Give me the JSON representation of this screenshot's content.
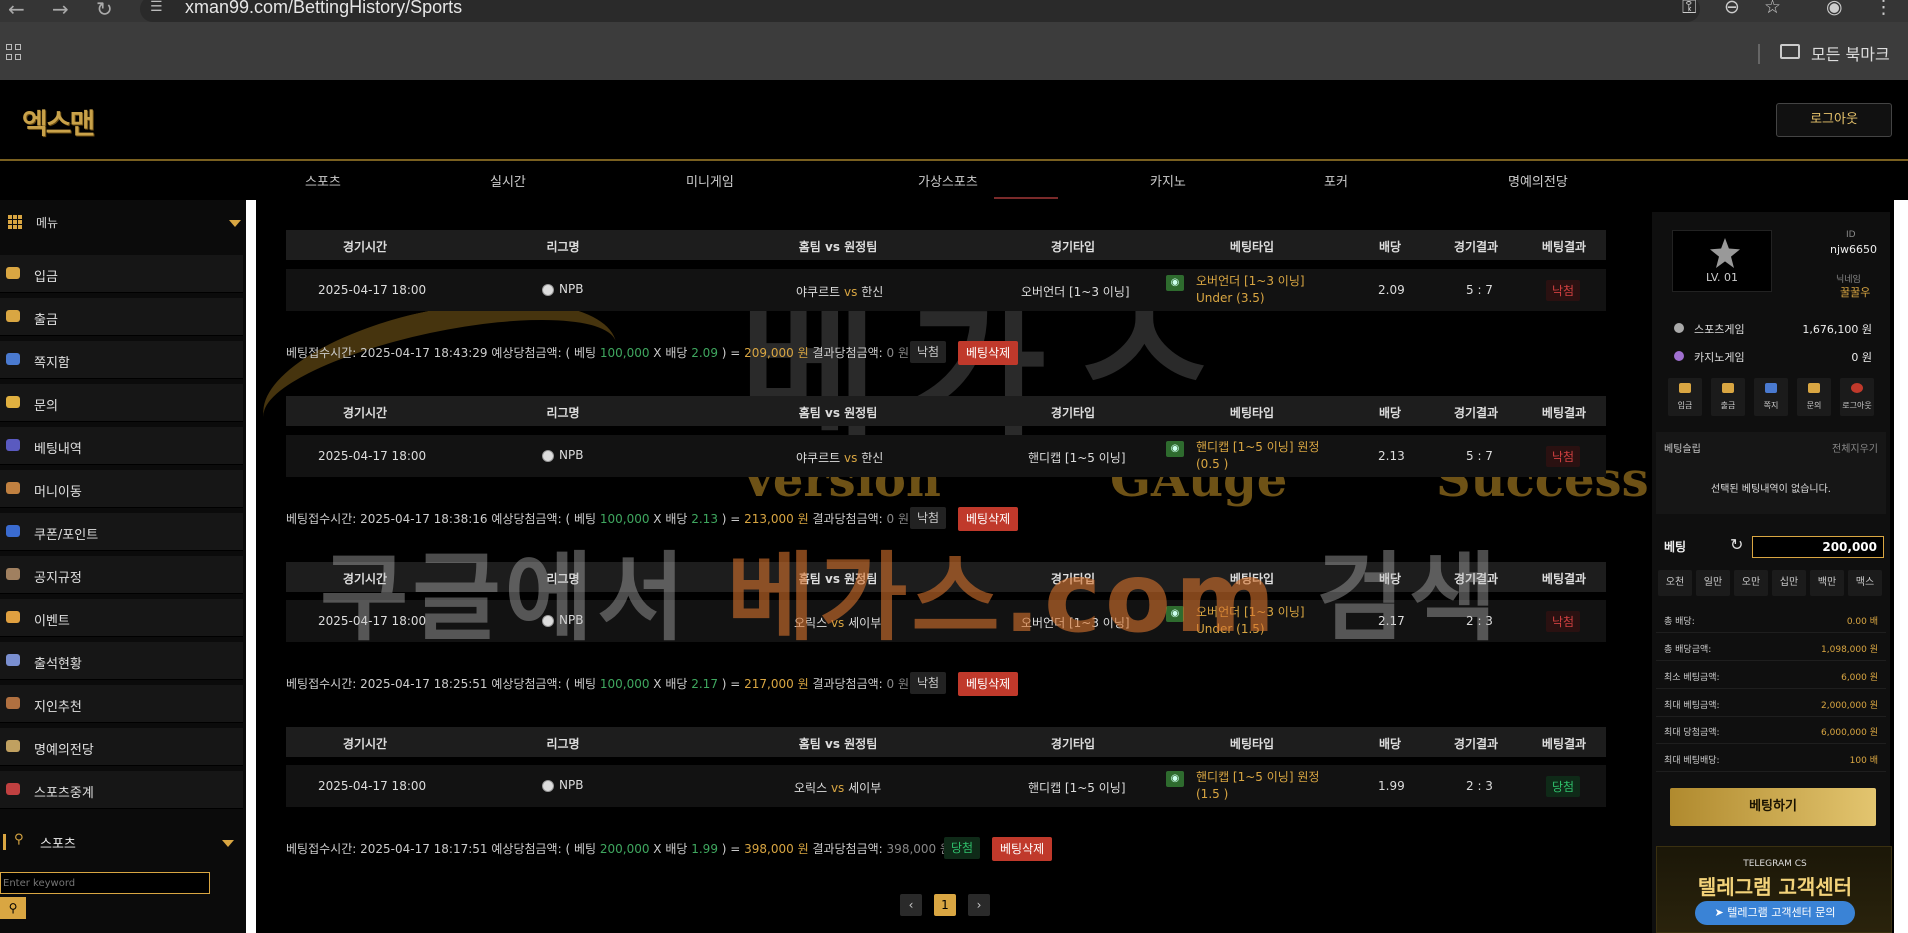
{
  "browser": {
    "url": "xman99.com/BettingHistory/Sports",
    "bookmarks_label": "모든 북마크"
  },
  "header": {
    "logout_label": "로그아웃"
  },
  "topnav": [
    "스포츠",
    "실시간",
    "미니게임",
    "가상스포츠",
    "카지노",
    "포커",
    "명예의전당"
  ],
  "sidebar": {
    "menu_title": "메뉴",
    "items": [
      "입금",
      "출금",
      "쪽지함",
      "문의",
      "베팅내역",
      "머니이동",
      "쿠폰/포인트",
      "공지규정",
      "이벤트",
      "출석현황",
      "지인추천",
      "명예의전당",
      "스포츠중계"
    ],
    "sports_label": "스포츠",
    "search_placeholder": "Enter keyword"
  },
  "columns": [
    "경기시간",
    "리그명",
    "홈팀 vs 원정팀",
    "경기타입",
    "베팅타입",
    "배당",
    "경기결과",
    "베팅결과"
  ],
  "bets": [
    {
      "time": "2025-04-17 18:00",
      "league": "NPB",
      "home": "야쿠르트",
      "vs": "vs",
      "away": "한신",
      "game_type": "오버언더 [1~3 이닝]",
      "bet_line1": "오버언더 [1~3 이닝]",
      "bet_line2": "Under (3.5)",
      "odds": "2.09",
      "score": "5 : 7",
      "result": "낙첨",
      "sum_prefix": "베팅접수시간: 2025-04-17 18:43:29  예상당첨금액: ( 베팅 ",
      "sum_stake": "100,000",
      "sum_mid": " X 배당 ",
      "sum_odds": "2.09",
      "sum_eq": " ) = ",
      "sum_expected": "209,000 원",
      "sum_paid_label": "  결과당첨금액: ",
      "sum_paid": "0 원",
      "sum_status": "낙첨",
      "delete_label": "베팅삭제"
    },
    {
      "time": "2025-04-17 18:00",
      "league": "NPB",
      "home": "야쿠르트",
      "vs": "vs",
      "away": "한신",
      "game_type": "핸디캡 [1~5 이닝]",
      "bet_line1": "핸디캡 [1~5 이닝] 원정",
      "bet_line2": "(0.5 )",
      "odds": "2.13",
      "score": "5 : 7",
      "result": "낙첨",
      "sum_prefix": "베팅접수시간: 2025-04-17 18:38:16  예상당첨금액: ( 베팅 ",
      "sum_stake": "100,000",
      "sum_mid": " X 배당 ",
      "sum_odds": "2.13",
      "sum_eq": " ) = ",
      "sum_expected": "213,000 원",
      "sum_paid_label": "  결과당첨금액: ",
      "sum_paid": "0 원",
      "sum_status": "낙첨",
      "delete_label": "베팅삭제"
    },
    {
      "time": "2025-04-17 18:00",
      "league": "NPB",
      "home": "오릭스",
      "vs": "vs",
      "away": "세이부",
      "game_type": "오버언더 [1~3 이닝]",
      "bet_line1": "오버언더 [1~3 이닝]",
      "bet_line2": "Under (1.5)",
      "odds": "2.17",
      "score": "2 : 3",
      "result": "낙첨",
      "sum_prefix": "베팅접수시간: 2025-04-17 18:25:51  예상당첨금액: ( 베팅 ",
      "sum_stake": "100,000",
      "sum_mid": " X 배당 ",
      "sum_odds": "2.17",
      "sum_eq": " ) = ",
      "sum_expected": "217,000 원",
      "sum_paid_label": "  결과당첨금액: ",
      "sum_paid": "0 원",
      "sum_status": "낙첨",
      "delete_label": "베팅삭제"
    },
    {
      "time": "2025-04-17 18:00",
      "league": "NPB",
      "home": "오릭스",
      "vs": "vs",
      "away": "세이부",
      "game_type": "핸디캡 [1~5 이닝]",
      "bet_line1": "핸디캡 [1~5 이닝] 원정",
      "bet_line2": "(1.5 )",
      "odds": "1.99",
      "score": "2 : 3",
      "result": "당첨",
      "sum_prefix": "베팅접수시간: 2025-04-17 18:17:51  예상당첨금액: ( 베팅 ",
      "sum_stake": "200,000",
      "sum_mid": " X 배당 ",
      "sum_odds": "1.99",
      "sum_eq": " ) = ",
      "sum_expected": "398,000 원",
      "sum_paid_label": "  결과당첨금액: ",
      "sum_paid": "398,000 원",
      "sum_status": "당첨",
      "delete_label": "베팅삭제"
    }
  ],
  "pager": {
    "prev": "‹",
    "current": "1",
    "next": "›"
  },
  "right_panel": {
    "level": "LV. 01",
    "id_label": "ID",
    "user_id": "njw6650",
    "nick_label": "닉네임",
    "nickname": "꿀꿀우",
    "wallets": [
      {
        "label": "스포츠게임",
        "amount": "1,676,100 원"
      },
      {
        "label": "카지노게임",
        "amount": "0 원"
      }
    ],
    "quick_buttons": [
      "입금",
      "출금",
      "쪽지",
      "문의",
      "로그아웃"
    ],
    "slip_title": "베팅슬립",
    "slip_clear": "전체지우기",
    "slip_empty": "선택된 베팅내역이 없습니다.",
    "stake_label": "베팅",
    "stake_value": "200,000",
    "chips": [
      "오천",
      "일만",
      "오만",
      "십만",
      "백만",
      "맥스"
    ],
    "info_rows": [
      {
        "label": "총 배당:",
        "value": "0.00 배"
      },
      {
        "label": "총 배당금액:",
        "value": "1,098,000 원"
      },
      {
        "label": "최소 베팅금액:",
        "value": "6,000 원"
      },
      {
        "label": "최대 베팅금액:",
        "value": "2,000,000 원"
      },
      {
        "label": "최대 당첨금액:",
        "value": "6,000,000 원"
      },
      {
        "label": "최대 베팅배당:",
        "value": "100 배"
      }
    ],
    "bet_button": "베팅하기",
    "telegram_small": "TELEGRAM CS",
    "telegram_big": "텔레그램 고객센터",
    "telegram_pill": "텔레그램 고객센터 문의"
  },
  "watermark": {
    "big": "베가스",
    "words": [
      "Version",
      "GAuge",
      "Success"
    ],
    "line_pre": "구글에서 ",
    "line_accent": "베가스.com",
    "line_post": " 검색"
  }
}
